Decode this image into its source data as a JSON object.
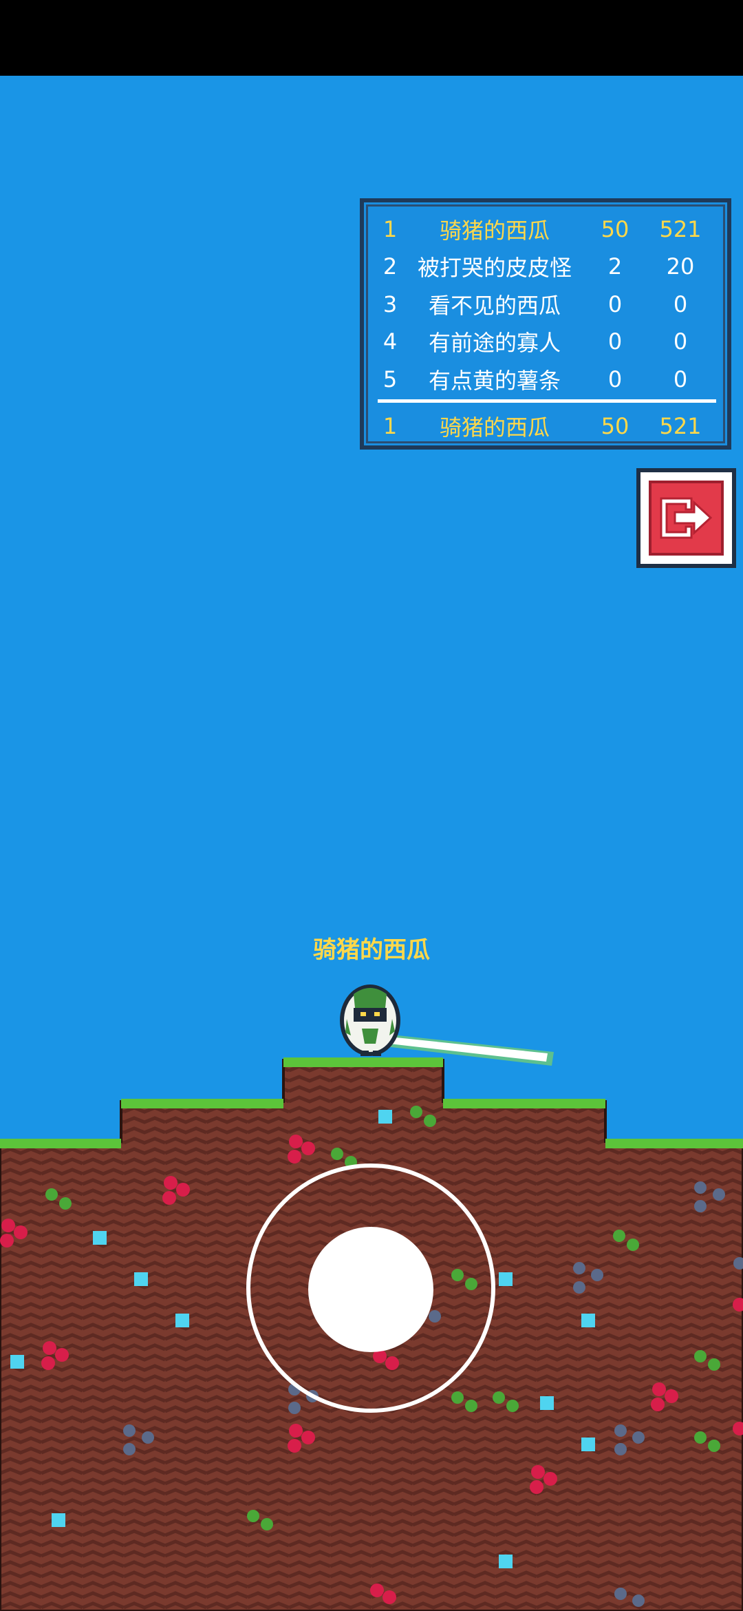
{
  "leaderboard": {
    "rows": [
      {
        "rank": "1",
        "name": "骑猪的西瓜",
        "kills": "50",
        "score": "521"
      },
      {
        "rank": "2",
        "name": "被打哭的皮皮怪",
        "kills": "2",
        "score": "20"
      },
      {
        "rank": "3",
        "name": "看不见的西瓜",
        "kills": "0",
        "score": "0"
      },
      {
        "rank": "4",
        "name": "有前途的寡人",
        "kills": "0",
        "score": "0"
      },
      {
        "rank": "5",
        "name": "有点黄的薯条",
        "kills": "0",
        "score": "0"
      }
    ],
    "self": {
      "rank": "1",
      "name": "骑猪的西瓜",
      "kills": "50",
      "score": "521"
    }
  },
  "player": {
    "name": "骑猪的西瓜"
  },
  "exit_button": {
    "icon": "exit-icon"
  },
  "colors": {
    "sky": "#1a95e6",
    "gold": "#ffd84a",
    "dirt": "#7a3a2e",
    "grass": "#5cc43a",
    "exit": "#e23a4a"
  }
}
